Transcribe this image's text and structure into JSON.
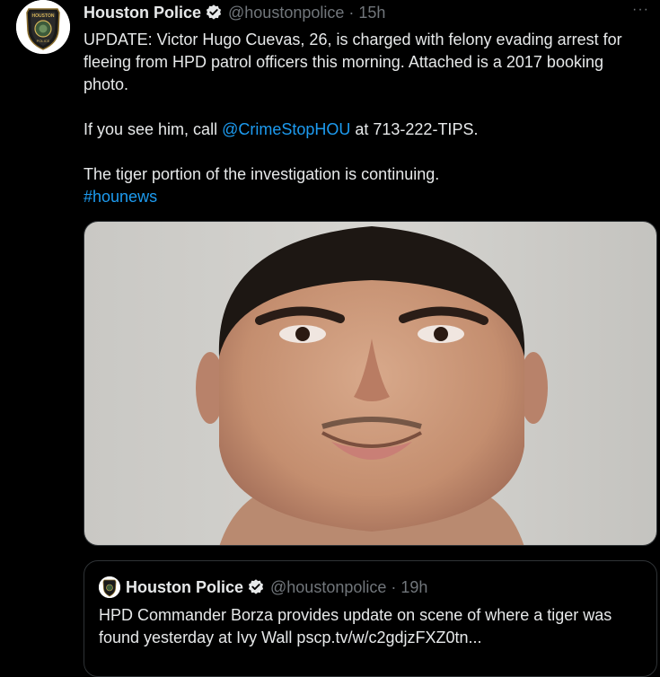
{
  "tweet": {
    "author_name": "Houston Police",
    "handle": "@houstonpolice",
    "separator": "·",
    "time": "15h",
    "more_label": "···",
    "text_line1": "UPDATE:  Victor Hugo Cuevas, 26, is charged with felony evading arrest for fleeing from HPD patrol officers this morning.  Attached is a 2017 booking photo.",
    "text_line2_prefix": "If you see him, call ",
    "mention": "@CrimeStopHOU",
    "text_line2_suffix": " at 713-222-TIPS.",
    "text_line3": "The tiger portion of the investigation is continuing.",
    "hashtag": "#hounews"
  },
  "quoted_tweet": {
    "author_name": "Houston Police",
    "handle": "@houstonpolice",
    "separator": "·",
    "time": "19h",
    "text": "HPD Commander Borza provides update on scene of where a tiger was found yesterday at Ivy Wall pscp.tv/w/c2gdjzFXZ0tn..."
  },
  "avatar_badge_text": "HOUSTON",
  "colors": {
    "background": "#000000",
    "text": "#e7e9ea",
    "secondary": "#71767b",
    "link": "#1d9bf0",
    "border": "#2f3336"
  }
}
